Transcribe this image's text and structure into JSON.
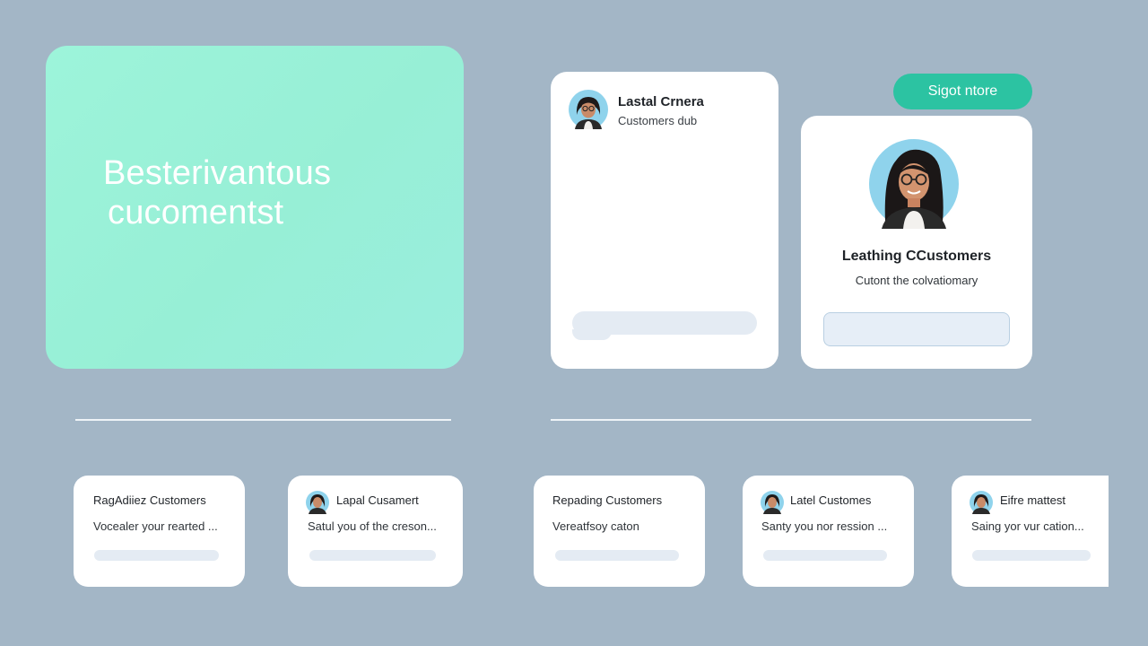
{
  "hero": {
    "title_line1": "Besterivantous",
    "title_line2": "cucomentst"
  },
  "card_left": {
    "avatar_icon": "person-avatar-icon",
    "title": "Lastal Crnera",
    "subtitle": "Customers dub"
  },
  "action_button": {
    "label": "Sigot ntore"
  },
  "card_profile": {
    "avatar_icon": "person-avatar-icon",
    "title": "Leathing CCustomers",
    "subtitle": "Cutont the colvatiomary"
  },
  "mini_cards": [
    {
      "title": "RagAdiiez Customers",
      "desc": "Vocealer your rearted ...",
      "has_avatar": false
    },
    {
      "title": "Lapal Cusamert",
      "desc": "Satul you of the creson...",
      "has_avatar": true
    },
    {
      "title": "Repading Customers",
      "desc": "Vereatfsoy caton",
      "has_avatar": false
    },
    {
      "title": "Latel Customes",
      "desc": "Santy you nor ression ...",
      "has_avatar": true
    },
    {
      "title": "Eifre mattest",
      "desc": "Saing yor vur cation...",
      "has_avatar": true
    }
  ],
  "colors": {
    "background": "#a3b6c6",
    "hero": "#9df4da",
    "accent": "#2cc3a2",
    "card": "#ffffff",
    "placeholder_bar": "#e4ebf3"
  }
}
